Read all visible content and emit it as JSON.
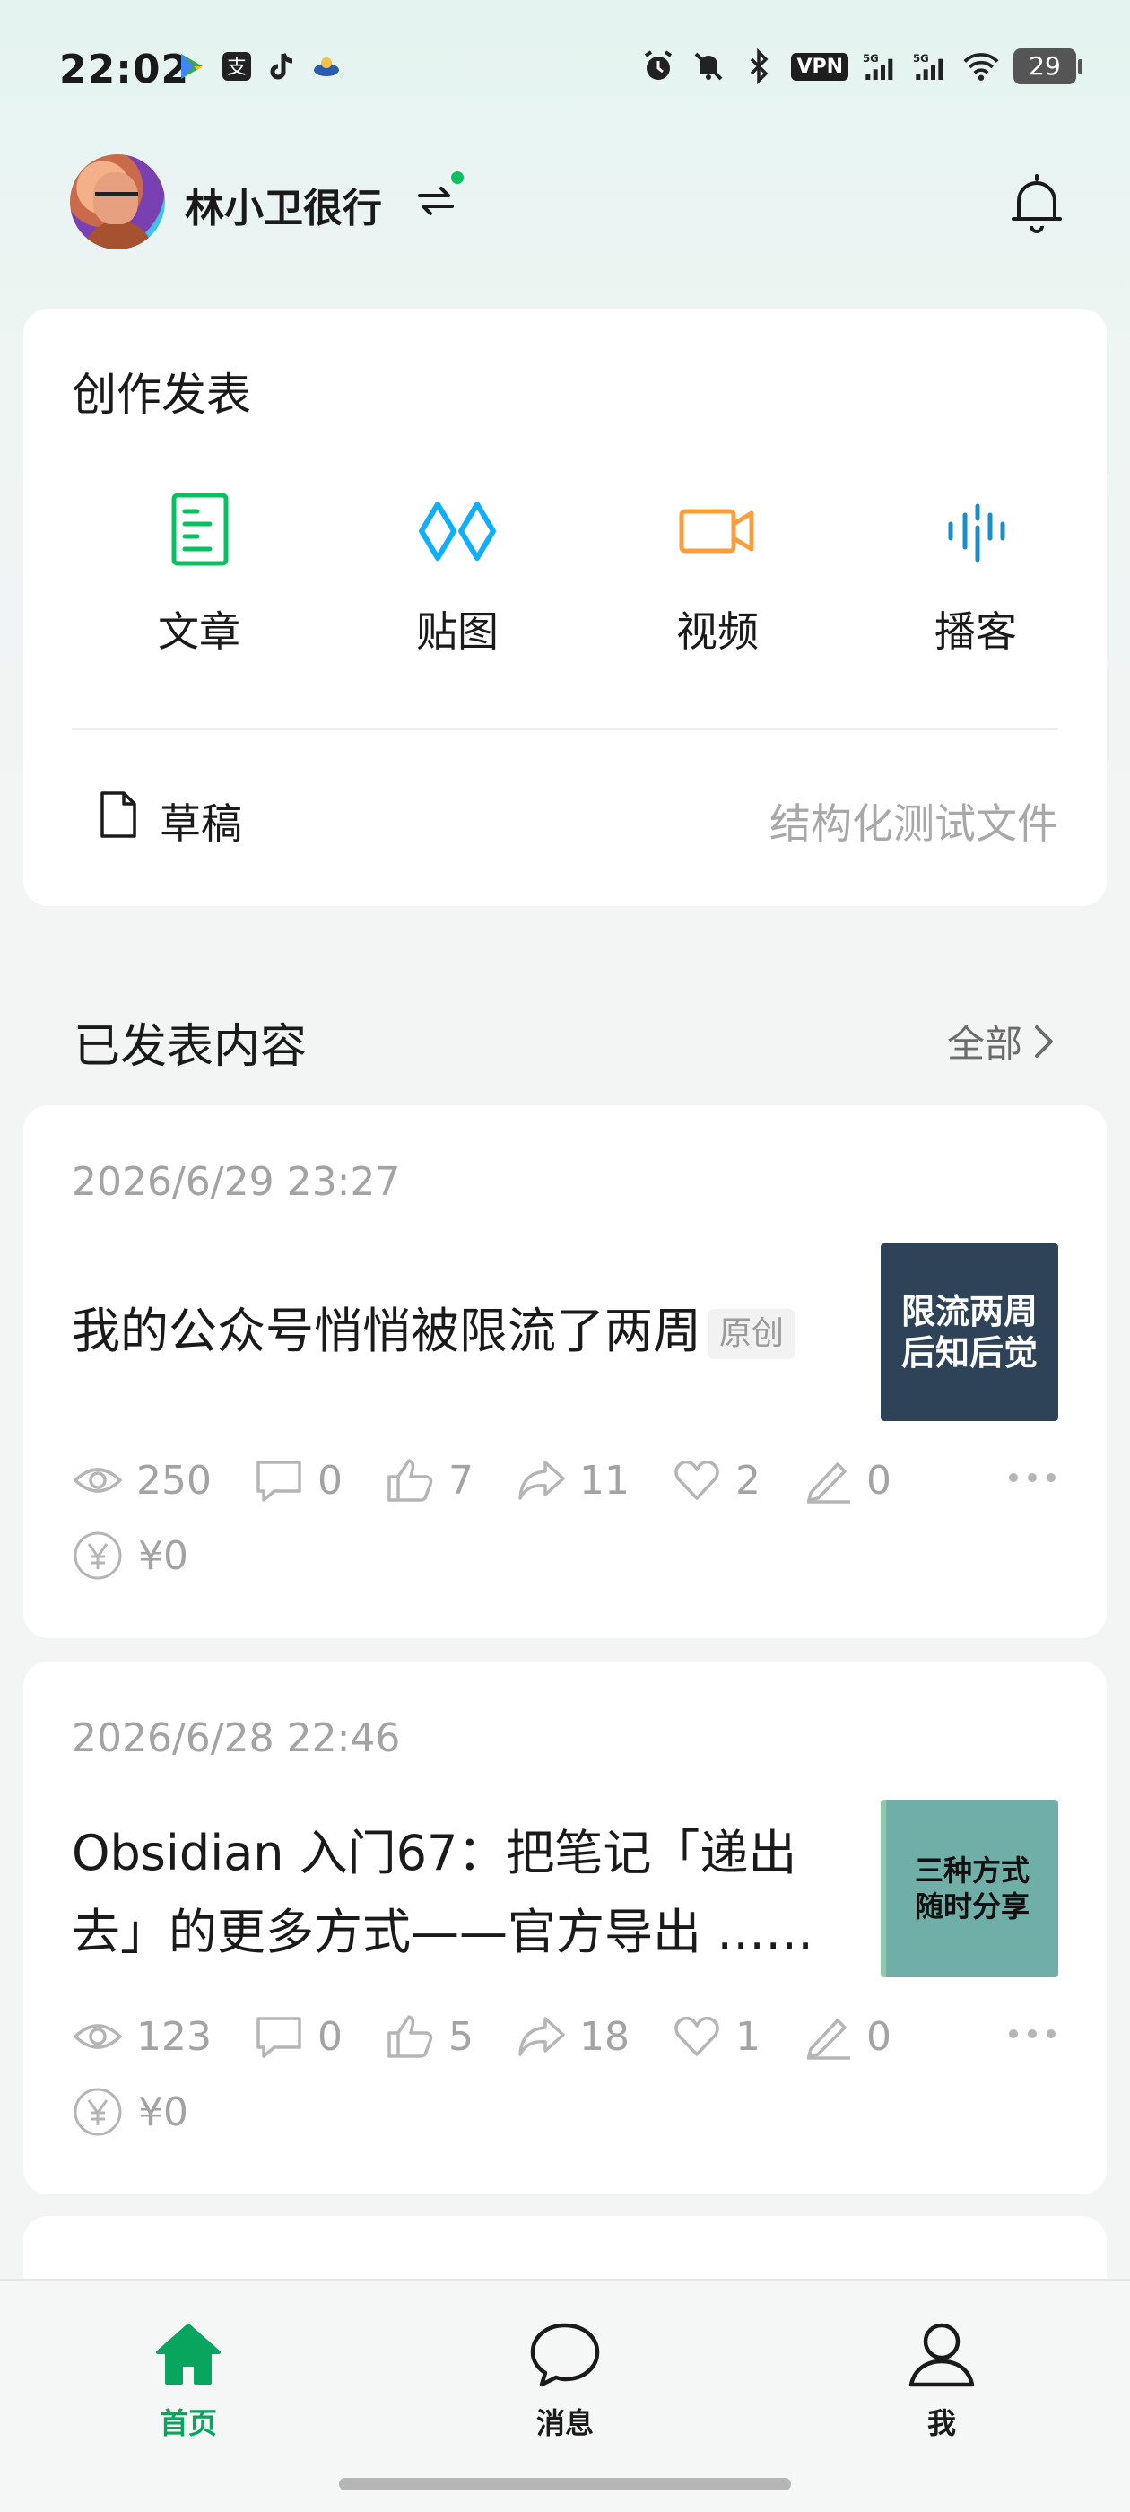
{
  "status_bar": {
    "time": "22:02",
    "app_icons": [
      "play-store-icon",
      "alipay-icon",
      "tiktok-icon",
      "app-icon"
    ],
    "vpn": "VPN",
    "battery": "29"
  },
  "account": {
    "name": "林小卫很行",
    "online": true,
    "accent_color": "#07c160"
  },
  "create": {
    "title": "创作发表",
    "items": [
      {
        "label": "文章",
        "icon": "article-icon",
        "color": "#07c160"
      },
      {
        "label": "贴图",
        "icon": "image-post-icon",
        "color": "#10aeff"
      },
      {
        "label": "视频",
        "icon": "video-icon",
        "color": "#fa9d3b"
      },
      {
        "label": "播客",
        "icon": "podcast-icon",
        "color": "#1b8ec9"
      }
    ],
    "drafts_label": "草稿",
    "drafts_latest": "结构化测试文件"
  },
  "published": {
    "title": "已发表内容",
    "view_all": "全部"
  },
  "posts": [
    {
      "date": "2026/6/29 23:27",
      "title": "我的公众号悄悄被限流了两周",
      "tag": "原创",
      "thumb_line1": "限流两周",
      "thumb_line2": "后知后觉",
      "thumb_color": "#2e4258",
      "stats": {
        "views": "250",
        "comments": "0",
        "likes": "7",
        "shares": "11",
        "favorites": "2",
        "notes": "0"
      },
      "earnings": "¥0"
    },
    {
      "date": "2026/6/28 22:46",
      "title_line1": "Obsidian 入门67：把笔记「递出",
      "title_line2": "去」的更多方式——官方导出 ……",
      "thumb_line1": "三种方式",
      "thumb_line2": "随时分享",
      "thumb_color": "#6fafa8",
      "stats": {
        "views": "123",
        "comments": "0",
        "likes": "5",
        "shares": "18",
        "favorites": "1",
        "notes": "0"
      },
      "earnings": "¥0"
    }
  ],
  "bottom_nav": [
    {
      "label": "首页",
      "icon": "home-icon",
      "active": true
    },
    {
      "label": "消息",
      "icon": "message-icon",
      "active": false
    },
    {
      "label": "我",
      "icon": "profile-icon",
      "active": false
    }
  ]
}
